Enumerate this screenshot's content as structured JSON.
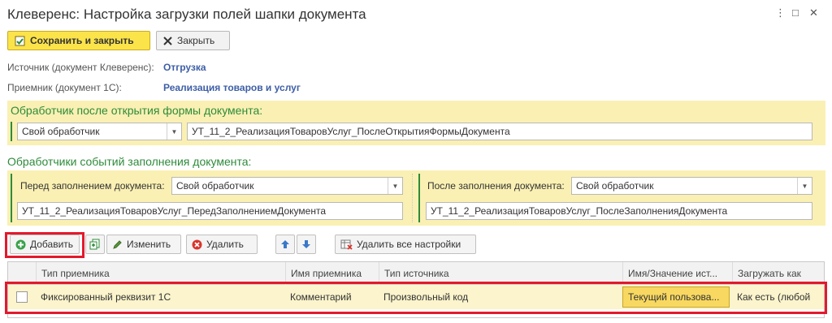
{
  "window": {
    "title": "Клеверенс: Настройка загрузки полей шапки документа",
    "more_glyph": "⋮",
    "maximize_glyph": "□",
    "close_glyph": "✕"
  },
  "toolbar": {
    "save_close_label": "Сохранить и закрыть",
    "close_label": "Закрыть"
  },
  "info": {
    "source_label": "Источник (документ Клеверенс):",
    "source_value": "Отгрузка",
    "receiver_label": "Приемник (документ 1С):",
    "receiver_value": "Реализация товаров и услуг"
  },
  "after_open": {
    "title": "Обработчик после открытия формы документа:",
    "handler_type": "Свой обработчик",
    "handler_name": "УТ_11_2_РеализацияТоваровУслуг_ПослеОткрытияФормыДокумента"
  },
  "fill_events": {
    "title": "Обработчики событий заполнения документа:",
    "before_label": "Перед заполнением документа:",
    "before_type": "Свой обработчик",
    "before_name": "УТ_11_2_РеализацияТоваровУслуг_ПередЗаполнениемДокумента",
    "after_label": "После заполнения документа:",
    "after_type": "Свой обработчик",
    "after_name": "УТ_11_2_РеализацияТоваровУслуг_ПослеЗаполненияДокумента"
  },
  "table_toolbar": {
    "add_label": "Добавить",
    "edit_label": "Изменить",
    "delete_label": "Удалить",
    "delete_all_label": "Удалить все настройки"
  },
  "table": {
    "columns": [
      "Тип приемника",
      "Имя приемника",
      "Тип источника",
      "Имя/Значение ист...",
      "Загружать как"
    ],
    "rows": [
      {
        "checked": false,
        "receiver_type": "Фиксированный реквизит 1С",
        "receiver_name": "Комментарий",
        "source_type": "Произвольный код",
        "source_value": "Текущий пользова...",
        "load_as": "Как есть (любой"
      }
    ]
  },
  "colors": {
    "accent_yellow": "#fbe34a",
    "section_green": "#2e8b3a",
    "link_blue": "#3d5ea6",
    "highlight_red": "#e3192c"
  }
}
